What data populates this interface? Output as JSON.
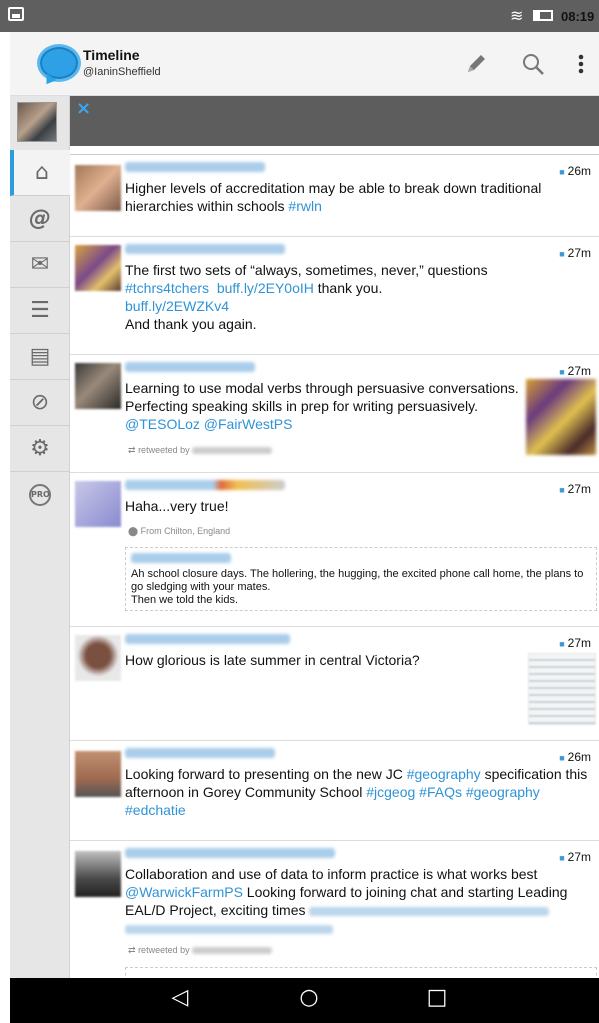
{
  "status_bar": {
    "time": "08:19"
  },
  "app_bar": {
    "title": "Timeline",
    "subtitle": "@IaninSheffield",
    "compose_icon": "pencil-icon",
    "search_icon": "search-icon",
    "more_icon": "more-vert-icon"
  },
  "sidebar": {
    "items": [
      {
        "icon": "home-icon",
        "glyph": "⌂",
        "active": true
      },
      {
        "icon": "mentions-icon",
        "glyph": "@"
      },
      {
        "icon": "messages-icon",
        "glyph": "✉"
      },
      {
        "icon": "lists-icon",
        "glyph": "☰"
      },
      {
        "icon": "profile-card-icon",
        "glyph": "▤"
      },
      {
        "icon": "mute-icon",
        "glyph": "⊘"
      },
      {
        "icon": "settings-icon",
        "glyph": "⚙"
      },
      {
        "icon": "pro-icon",
        "glyph": "PRO"
      }
    ]
  },
  "banner": {
    "close_glyph": "×"
  },
  "tweets": [
    {
      "time": "26m",
      "text_parts": [
        "Higher levels of accreditation may be able to break down traditional hierarchies within schools ",
        "#rwln"
      ]
    },
    {
      "time": "27m",
      "line1": "The first two sets of “always, sometimes, never,” questions",
      "line2_links": [
        "#tchrs4tchers",
        "buff.ly/2EY0oIH"
      ],
      "line2_tail": " thank you.",
      "line3_link": "buff.ly/2EWZKv4",
      "line4": "And thank you again."
    },
    {
      "time": "27m",
      "text": "Learning to use modal verbs through persuasive conversations. Perfecting speaking skills in prep for writing persuasively. ",
      "mentions": [
        "@TESOLoz",
        "@FairWestPS"
      ],
      "retweeted_by": "retweeted by"
    },
    {
      "time": "27m",
      "text": "Haha...very true!",
      "location": "From Chilton, England",
      "quote": "Ah school closure days. The hollering, the hugging, the excited phone call home, the plans to go sledging with your mates.\nThen we told the kids."
    },
    {
      "time": "27m",
      "text": "How glorious is late summer in central Victoria?"
    },
    {
      "time": "26m",
      "text_a": "Looking forward to presenting on the new JC ",
      "tag_a": "#geography",
      "text_b": " specification this afternoon in Gorey Community School ",
      "tags_b": [
        "#jcgeog",
        "#FAQs",
        "#geography"
      ],
      "tag_c": "#edchatie"
    },
    {
      "time": "27m",
      "line1": "Collaboration and use of data to inform practice is what works best",
      "mention": "@WarwickFarmPS",
      "line2_tail": " Looking forward to joining chat and starting Leading",
      "line3": "EAL/D Project, exciting times ",
      "retweeted_by": "retweeted by"
    }
  ],
  "nav_bar": {
    "back_glyph": "◁",
    "home_glyph": "○",
    "recent_glyph": "□"
  }
}
